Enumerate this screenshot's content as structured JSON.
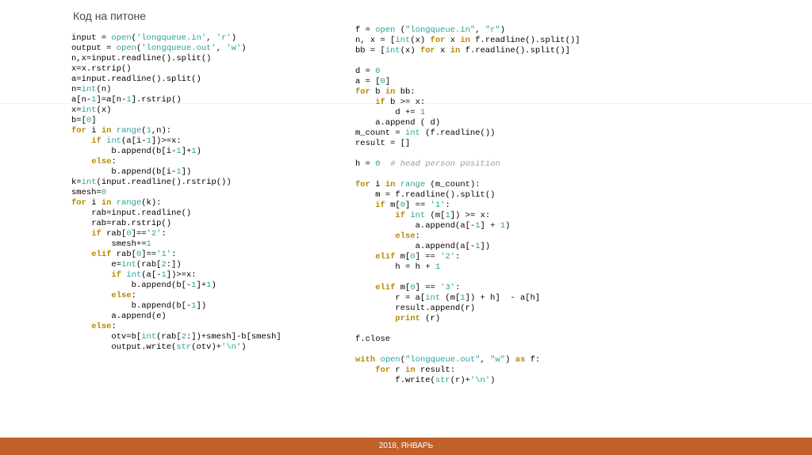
{
  "title": "Код на питоне",
  "footer": "2018, ЯНВАРЬ",
  "code_left": [
    {
      "t": "input = ",
      "c": ""
    },
    {
      "t": "open",
      "c": "func"
    },
    {
      "t": "(",
      "c": ""
    },
    {
      "t": "'longqueue.in'",
      "c": "str"
    },
    {
      "t": ", ",
      "c": ""
    },
    {
      "t": "'r'",
      "c": "str"
    },
    {
      "t": ")\n",
      "c": ""
    },
    {
      "t": "output = ",
      "c": ""
    },
    {
      "t": "open",
      "c": "func"
    },
    {
      "t": "(",
      "c": ""
    },
    {
      "t": "'longqueue.out'",
      "c": "str"
    },
    {
      "t": ", ",
      "c": ""
    },
    {
      "t": "'w'",
      "c": "str"
    },
    {
      "t": ")\n",
      "c": ""
    },
    {
      "t": "n,x=input.readline().split()\n",
      "c": ""
    },
    {
      "t": "x=x.rstrip()\n",
      "c": ""
    },
    {
      "t": "a=input.readline().split()\n",
      "c": ""
    },
    {
      "t": "n=",
      "c": ""
    },
    {
      "t": "int",
      "c": "func"
    },
    {
      "t": "(n)\n",
      "c": ""
    },
    {
      "t": "a[n-",
      "c": ""
    },
    {
      "t": "1",
      "c": "num"
    },
    {
      "t": "]=a[n-",
      "c": ""
    },
    {
      "t": "1",
      "c": "num"
    },
    {
      "t": "].rstrip()\n",
      "c": ""
    },
    {
      "t": "x=",
      "c": ""
    },
    {
      "t": "int",
      "c": "func"
    },
    {
      "t": "(x)\n",
      "c": ""
    },
    {
      "t": "b=[",
      "c": ""
    },
    {
      "t": "0",
      "c": "num"
    },
    {
      "t": "]\n",
      "c": ""
    },
    {
      "t": "for",
      "c": "kw"
    },
    {
      "t": " i ",
      "c": ""
    },
    {
      "t": "in",
      "c": "kw"
    },
    {
      "t": " ",
      "c": ""
    },
    {
      "t": "range",
      "c": "func"
    },
    {
      "t": "(",
      "c": ""
    },
    {
      "t": "1",
      "c": "num"
    },
    {
      "t": ",n):\n",
      "c": ""
    },
    {
      "t": "    ",
      "c": ""
    },
    {
      "t": "if",
      "c": "kw"
    },
    {
      "t": " ",
      "c": ""
    },
    {
      "t": "int",
      "c": "func"
    },
    {
      "t": "(a[i-",
      "c": ""
    },
    {
      "t": "1",
      "c": "num"
    },
    {
      "t": "])>=x:\n",
      "c": ""
    },
    {
      "t": "        b.append(b[i-",
      "c": ""
    },
    {
      "t": "1",
      "c": "num"
    },
    {
      "t": "]+",
      "c": ""
    },
    {
      "t": "1",
      "c": "num"
    },
    {
      "t": ")\n",
      "c": ""
    },
    {
      "t": "    ",
      "c": ""
    },
    {
      "t": "else",
      "c": "kw"
    },
    {
      "t": ":\n",
      "c": ""
    },
    {
      "t": "        b.append(b[i-",
      "c": ""
    },
    {
      "t": "1",
      "c": "num"
    },
    {
      "t": "])\n",
      "c": ""
    },
    {
      "t": "k=",
      "c": ""
    },
    {
      "t": "int",
      "c": "func"
    },
    {
      "t": "(input.readline().rstrip())\n",
      "c": ""
    },
    {
      "t": "smesh=",
      "c": ""
    },
    {
      "t": "0",
      "c": "num"
    },
    {
      "t": "\n",
      "c": ""
    },
    {
      "t": "for",
      "c": "kw"
    },
    {
      "t": " i ",
      "c": ""
    },
    {
      "t": "in",
      "c": "kw"
    },
    {
      "t": " ",
      "c": ""
    },
    {
      "t": "range",
      "c": "func"
    },
    {
      "t": "(k):\n",
      "c": ""
    },
    {
      "t": "    rab=input.readline()\n",
      "c": ""
    },
    {
      "t": "    rab=rab.rstrip()\n",
      "c": ""
    },
    {
      "t": "    ",
      "c": ""
    },
    {
      "t": "if",
      "c": "kw"
    },
    {
      "t": " rab[",
      "c": ""
    },
    {
      "t": "0",
      "c": "num"
    },
    {
      "t": "]==",
      "c": ""
    },
    {
      "t": "'2'",
      "c": "str"
    },
    {
      "t": ":\n",
      "c": ""
    },
    {
      "t": "        smesh+=",
      "c": ""
    },
    {
      "t": "1",
      "c": "num"
    },
    {
      "t": "\n",
      "c": ""
    },
    {
      "t": "    ",
      "c": ""
    },
    {
      "t": "elif",
      "c": "kw"
    },
    {
      "t": " rab[",
      "c": ""
    },
    {
      "t": "0",
      "c": "num"
    },
    {
      "t": "]==",
      "c": ""
    },
    {
      "t": "'1'",
      "c": "str"
    },
    {
      "t": ":\n",
      "c": ""
    },
    {
      "t": "        e=",
      "c": ""
    },
    {
      "t": "int",
      "c": "func"
    },
    {
      "t": "(rab[",
      "c": ""
    },
    {
      "t": "2",
      "c": "num"
    },
    {
      "t": ":])\n",
      "c": ""
    },
    {
      "t": "        ",
      "c": ""
    },
    {
      "t": "if",
      "c": "kw"
    },
    {
      "t": " ",
      "c": ""
    },
    {
      "t": "int",
      "c": "func"
    },
    {
      "t": "(a[-",
      "c": ""
    },
    {
      "t": "1",
      "c": "num"
    },
    {
      "t": "])>=x:\n",
      "c": ""
    },
    {
      "t": "            b.append(b[-",
      "c": ""
    },
    {
      "t": "1",
      "c": "num"
    },
    {
      "t": "]+",
      "c": ""
    },
    {
      "t": "1",
      "c": "num"
    },
    {
      "t": ")\n",
      "c": ""
    },
    {
      "t": "        ",
      "c": ""
    },
    {
      "t": "else",
      "c": "kw"
    },
    {
      "t": ":\n",
      "c": ""
    },
    {
      "t": "            b.append(b[-",
      "c": ""
    },
    {
      "t": "1",
      "c": "num"
    },
    {
      "t": "])\n",
      "c": ""
    },
    {
      "t": "        a.append(e)\n",
      "c": ""
    },
    {
      "t": "    ",
      "c": ""
    },
    {
      "t": "else",
      "c": "kw"
    },
    {
      "t": ":\n",
      "c": ""
    },
    {
      "t": "        otv=b[",
      "c": ""
    },
    {
      "t": "int",
      "c": "func"
    },
    {
      "t": "(rab[",
      "c": ""
    },
    {
      "t": "2",
      "c": "num"
    },
    {
      "t": ":])+smesh]-b[smesh]\n",
      "c": ""
    },
    {
      "t": "        output.write(",
      "c": ""
    },
    {
      "t": "str",
      "c": "func"
    },
    {
      "t": "(otv)+",
      "c": ""
    },
    {
      "t": "'\\n'",
      "c": "str"
    },
    {
      "t": ")\n",
      "c": ""
    }
  ],
  "code_right": [
    {
      "t": "f = ",
      "c": ""
    },
    {
      "t": "open",
      "c": "func"
    },
    {
      "t": " (",
      "c": ""
    },
    {
      "t": "\"longqueue.in\"",
      "c": "str"
    },
    {
      "t": ", ",
      "c": ""
    },
    {
      "t": "\"r\"",
      "c": "str"
    },
    {
      "t": ")\n",
      "c": ""
    },
    {
      "t": "n, x = [",
      "c": ""
    },
    {
      "t": "int",
      "c": "func"
    },
    {
      "t": "(x) ",
      "c": ""
    },
    {
      "t": "for",
      "c": "kw"
    },
    {
      "t": " x ",
      "c": ""
    },
    {
      "t": "in",
      "c": "kw"
    },
    {
      "t": " f.readline().split()]\n",
      "c": ""
    },
    {
      "t": "bb = [",
      "c": ""
    },
    {
      "t": "int",
      "c": "func"
    },
    {
      "t": "(x) ",
      "c": ""
    },
    {
      "t": "for",
      "c": "kw"
    },
    {
      "t": " x ",
      "c": ""
    },
    {
      "t": "in",
      "c": "kw"
    },
    {
      "t": " f.readline().split()]\n",
      "c": ""
    },
    {
      "t": "\n",
      "c": ""
    },
    {
      "t": "d = ",
      "c": ""
    },
    {
      "t": "0",
      "c": "num"
    },
    {
      "t": "\n",
      "c": ""
    },
    {
      "t": "a = [",
      "c": ""
    },
    {
      "t": "0",
      "c": "num"
    },
    {
      "t": "]\n",
      "c": ""
    },
    {
      "t": "for",
      "c": "kw"
    },
    {
      "t": " b ",
      "c": ""
    },
    {
      "t": "in",
      "c": "kw"
    },
    {
      "t": " bb:\n",
      "c": ""
    },
    {
      "t": "    ",
      "c": ""
    },
    {
      "t": "if",
      "c": "kw"
    },
    {
      "t": " b >= x:\n",
      "c": ""
    },
    {
      "t": "        d += ",
      "c": ""
    },
    {
      "t": "1",
      "c": "num"
    },
    {
      "t": "\n",
      "c": ""
    },
    {
      "t": "    a.append ( d)\n",
      "c": ""
    },
    {
      "t": "m_count = ",
      "c": ""
    },
    {
      "t": "int",
      "c": "func"
    },
    {
      "t": " (f.readline())\n",
      "c": ""
    },
    {
      "t": "result = []\n",
      "c": ""
    },
    {
      "t": "\n",
      "c": ""
    },
    {
      "t": "h = ",
      "c": ""
    },
    {
      "t": "0",
      "c": "num"
    },
    {
      "t": "  ",
      "c": ""
    },
    {
      "t": "# head person position",
      "c": "cmt"
    },
    {
      "t": "\n",
      "c": ""
    },
    {
      "t": "\n",
      "c": ""
    },
    {
      "t": "for",
      "c": "kw"
    },
    {
      "t": " i ",
      "c": ""
    },
    {
      "t": "in",
      "c": "kw"
    },
    {
      "t": " ",
      "c": ""
    },
    {
      "t": "range",
      "c": "func"
    },
    {
      "t": " (m_count):\n",
      "c": ""
    },
    {
      "t": "    m = f.readline().split()\n",
      "c": ""
    },
    {
      "t": "    ",
      "c": ""
    },
    {
      "t": "if",
      "c": "kw"
    },
    {
      "t": " m[",
      "c": ""
    },
    {
      "t": "0",
      "c": "num"
    },
    {
      "t": "] == ",
      "c": ""
    },
    {
      "t": "'1'",
      "c": "str"
    },
    {
      "t": ":\n",
      "c": ""
    },
    {
      "t": "        ",
      "c": ""
    },
    {
      "t": "if",
      "c": "kw"
    },
    {
      "t": " ",
      "c": ""
    },
    {
      "t": "int",
      "c": "func"
    },
    {
      "t": " (m[",
      "c": ""
    },
    {
      "t": "1",
      "c": "num"
    },
    {
      "t": "]) >= x:\n",
      "c": ""
    },
    {
      "t": "            a.append(a[-",
      "c": ""
    },
    {
      "t": "1",
      "c": "num"
    },
    {
      "t": "] + ",
      "c": ""
    },
    {
      "t": "1",
      "c": "num"
    },
    {
      "t": ")\n",
      "c": ""
    },
    {
      "t": "        ",
      "c": ""
    },
    {
      "t": "else",
      "c": "kw"
    },
    {
      "t": ":\n",
      "c": ""
    },
    {
      "t": "            a.append(a[-",
      "c": ""
    },
    {
      "t": "1",
      "c": "num"
    },
    {
      "t": "])\n",
      "c": ""
    },
    {
      "t": "    ",
      "c": ""
    },
    {
      "t": "elif",
      "c": "kw"
    },
    {
      "t": " m[",
      "c": ""
    },
    {
      "t": "0",
      "c": "num"
    },
    {
      "t": "] == ",
      "c": ""
    },
    {
      "t": "'2'",
      "c": "str"
    },
    {
      "t": ":\n",
      "c": ""
    },
    {
      "t": "        h = h + ",
      "c": ""
    },
    {
      "t": "1",
      "c": "num"
    },
    {
      "t": "\n",
      "c": ""
    },
    {
      "t": "\n",
      "c": ""
    },
    {
      "t": "    ",
      "c": ""
    },
    {
      "t": "elif",
      "c": "kw"
    },
    {
      "t": " m[",
      "c": ""
    },
    {
      "t": "0",
      "c": "num"
    },
    {
      "t": "] == ",
      "c": ""
    },
    {
      "t": "'3'",
      "c": "str"
    },
    {
      "t": ":\n",
      "c": ""
    },
    {
      "t": "        r = a[",
      "c": ""
    },
    {
      "t": "int",
      "c": "func"
    },
    {
      "t": " (m[",
      "c": ""
    },
    {
      "t": "1",
      "c": "num"
    },
    {
      "t": "]) + h]  - a[h]\n",
      "c": ""
    },
    {
      "t": "        result.append(r)\n",
      "c": ""
    },
    {
      "t": "        ",
      "c": ""
    },
    {
      "t": "print",
      "c": "kw"
    },
    {
      "t": " (r)\n",
      "c": ""
    },
    {
      "t": "\n",
      "c": ""
    },
    {
      "t": "f.close\n",
      "c": ""
    },
    {
      "t": "\n",
      "c": ""
    },
    {
      "t": "with",
      "c": "kw"
    },
    {
      "t": " ",
      "c": ""
    },
    {
      "t": "open",
      "c": "func"
    },
    {
      "t": "(",
      "c": ""
    },
    {
      "t": "\"longqueue.out\"",
      "c": "str"
    },
    {
      "t": ", ",
      "c": ""
    },
    {
      "t": "\"w\"",
      "c": "str"
    },
    {
      "t": ") ",
      "c": ""
    },
    {
      "t": "as",
      "c": "kw"
    },
    {
      "t": " f:\n",
      "c": ""
    },
    {
      "t": "    ",
      "c": ""
    },
    {
      "t": "for",
      "c": "kw"
    },
    {
      "t": " r ",
      "c": ""
    },
    {
      "t": "in",
      "c": "kw"
    },
    {
      "t": " result:\n",
      "c": ""
    },
    {
      "t": "        f.write(",
      "c": ""
    },
    {
      "t": "str",
      "c": "func"
    },
    {
      "t": "(r)+",
      "c": ""
    },
    {
      "t": "'\\n'",
      "c": "str"
    },
    {
      "t": ")\n",
      "c": ""
    }
  ]
}
